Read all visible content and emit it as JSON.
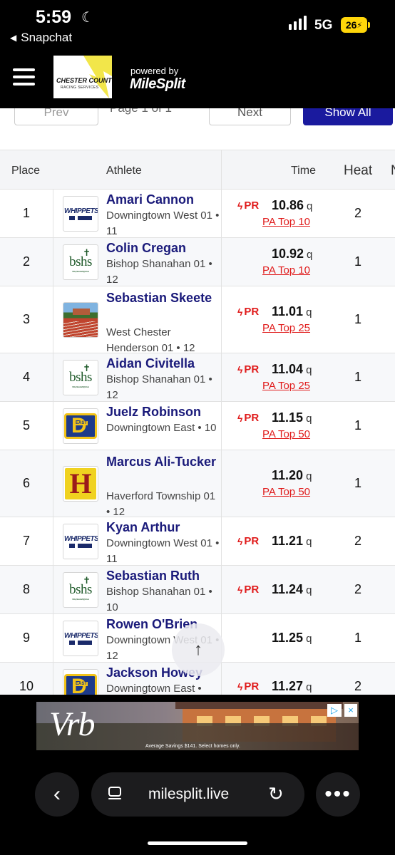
{
  "status_bar": {
    "time": "5:59",
    "back_app": "Snapchat",
    "network": "5G",
    "battery": "26"
  },
  "header": {
    "logo_line1": "CHESTER COUNTY",
    "logo_line2": "RACING SERVICES",
    "powered_by": "powered by",
    "brand": "MileSplit"
  },
  "pager": {
    "prev_label": "Prev",
    "page_label": "Page 1 of 1",
    "next_label": "Next",
    "show_all_label": "Show All"
  },
  "table": {
    "headers": {
      "place": "Place",
      "athlete": "Athlete",
      "time": "Time",
      "heat": "Heat",
      "extra": "N"
    },
    "rows": [
      {
        "place": "1",
        "name": "Amari Cannon",
        "team": "Downingtown West",
        "meta": "01 • 11",
        "team_logo": "whippets",
        "pr": "PR",
        "time": "10.86",
        "q": "q",
        "rank": "PA Top 10",
        "heat": "2"
      },
      {
        "place": "2",
        "name": "Colin Cregan",
        "team": "Bishop Shanahan",
        "meta": "01 • 12",
        "team_logo": "bshs",
        "pr": "",
        "time": "10.92",
        "q": "q",
        "rank": "PA Top 10",
        "heat": "1"
      },
      {
        "place": "3",
        "name": "Sebastian Skeete",
        "team": "West Chester Henderson",
        "meta": "01 • 12",
        "team_logo": "henderson",
        "pr": "PR",
        "time": "11.01",
        "q": "q",
        "rank": "PA Top 25",
        "heat": "1"
      },
      {
        "place": "4",
        "name": "Aidan Civitella",
        "team": "Bishop Shanahan",
        "meta": "01 • 12",
        "team_logo": "bshs",
        "pr": "PR",
        "time": "11.04",
        "q": "q",
        "rank": "PA Top 25",
        "heat": "1"
      },
      {
        "place": "5",
        "name": "Juelz Robinson",
        "team": "Downingtown East",
        "meta": "• 10",
        "team_logo": "east",
        "pr": "PR",
        "time": "11.15",
        "q": "q",
        "rank": "PA Top 50",
        "heat": "1"
      },
      {
        "place": "6",
        "name": "Marcus Ali-Tucker",
        "team": "Haverford Township",
        "meta": "01 • 12",
        "team_logo": "haverford",
        "pr": "",
        "time": "11.20",
        "q": "q",
        "rank": "PA Top 50",
        "heat": "1"
      },
      {
        "place": "7",
        "name": "Kyan Arthur",
        "team": "Downingtown West",
        "meta": "01 • 11",
        "team_logo": "whippets",
        "pr": "PR",
        "time": "11.21",
        "q": "q",
        "rank": "",
        "heat": "2"
      },
      {
        "place": "8",
        "name": "Sebastian Ruth",
        "team": "Bishop Shanahan",
        "meta": "01 • 10",
        "team_logo": "bshs",
        "pr": "PR",
        "time": "11.24",
        "q": "q",
        "rank": "",
        "heat": "2"
      },
      {
        "place": "9",
        "name": "Rowen O'Brien",
        "team": "Downingtown West",
        "meta": "01 • 12",
        "team_logo": "whippets",
        "pr": "",
        "time": "11.25",
        "q": "q",
        "rank": "",
        "heat": "1"
      },
      {
        "place": "10",
        "name": "Jackson Howey",
        "team": "Downingtown East",
        "meta": "•",
        "team_logo": "east",
        "pr": "PR",
        "time": "11.27",
        "q": "q",
        "rank": "",
        "heat": "2"
      }
    ],
    "logo_text": {
      "whippets": "WHIPPETS",
      "bshs": "bshs",
      "bshs_sub": "Bishop Shanahan High School",
      "east": "D",
      "east_small": "EAST",
      "haverford": "H"
    }
  },
  "ad": {
    "brand": "Vrb",
    "caption": "Average Savings $141. Select homes only."
  },
  "bottom_bar": {
    "url": "milesplit.live"
  },
  "icons": {
    "back": "chevron-left-icon",
    "more": "ellipsis-icon",
    "reload": "reload-icon",
    "tabs": "tab-view-icon",
    "scroll_top": "arrow-up-icon"
  },
  "colors": {
    "brand_navy": "#1a1a7a",
    "pr_red": "#e01b1b",
    "show_all_blue": "#1a1a9e"
  }
}
